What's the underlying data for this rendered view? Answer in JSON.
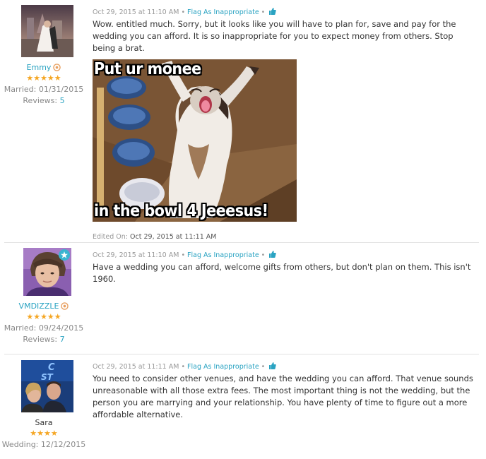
{
  "comments": [
    {
      "author": "Emmy",
      "stars": "★★★★★",
      "meta_label": "Married:",
      "meta_value": "01/31/2015",
      "reviews_label": "Reviews:",
      "reviews_count": "5",
      "timestamp": "Oct 29, 2015 at 11:10 AM",
      "flag_label": "Flag As Inappropriate",
      "text": "Wow. entitled much. Sorry, but it looks like you will have to plan for, save and pay for the wedding you can afford. It is so inappropriate for you to expect money from others. Stop being a brat.",
      "meme_top": "Put ur monee",
      "meme_bottom": "in the bowl 4 Jeeesus!",
      "edited_label": "Edited On:",
      "edited_value": "Oct 29, 2015 at 11:11 AM"
    },
    {
      "author": "VMDIZZLE",
      "stars": "★★★★★",
      "meta_label": "Married:",
      "meta_value": "09/24/2015",
      "reviews_label": "Reviews:",
      "reviews_count": "7",
      "timestamp": "Oct 29, 2015 at 11:10 AM",
      "flag_label": "Flag As Inappropriate",
      "text": "Have a wedding you can afford, welcome gifts from others, but don't plan on them. This isn't 1960."
    },
    {
      "author": "Sara",
      "stars": "★★★★",
      "meta_label": "Wedding:",
      "meta_value": "12/12/2015",
      "timestamp": "Oct 29, 2015 at 11:11 AM",
      "flag_label": "Flag As Inappropriate",
      "text": "You need to consider other venues, and have the wedding you can afford. That venue sounds unreasonable with all those extra fees. The most important thing is not the wedding, but the person you are marrying and your relationship. You have plenty of time to figure out a more affordable alternative."
    }
  ],
  "colors": {
    "link": "#2aa3c2",
    "star": "#f5a623",
    "muted": "#999999",
    "rank_badge": "#e8a060"
  },
  "icons": [
    "rank-badge-icon",
    "thumbs-up-icon",
    "star-badge-icon"
  ]
}
